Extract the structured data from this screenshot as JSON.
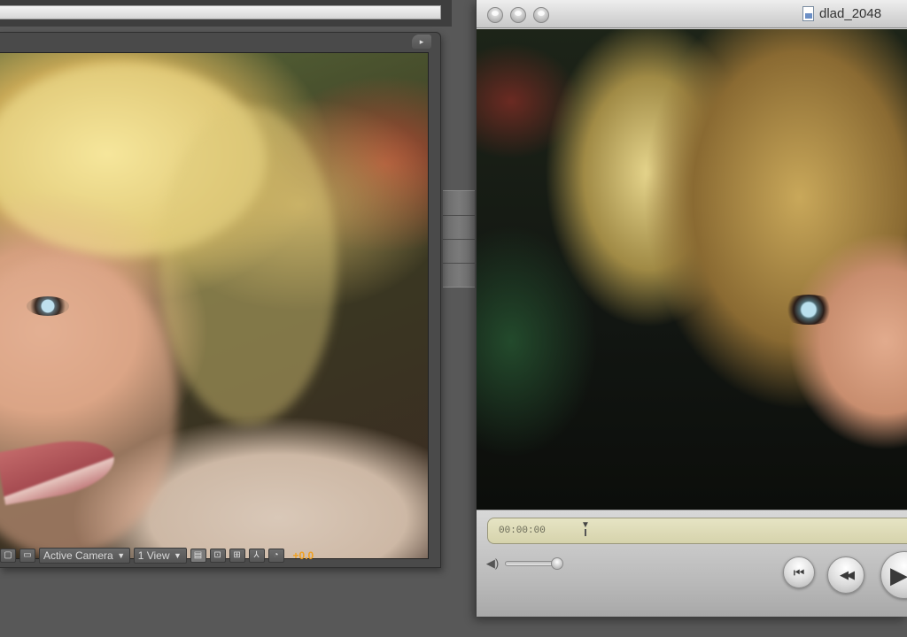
{
  "comp_viewer": {
    "menu_icon": "panel-menu-icon",
    "toolbar": {
      "camera_select": "Active Camera",
      "view_select": "1 View",
      "exposure_value": "+0.0",
      "icons": [
        "region-of-interest-icon",
        "comment-icon",
        "toggle-view-icon",
        "fit-icon",
        "grid-icon",
        "flowchart-icon",
        "reset-exposure-icon"
      ]
    }
  },
  "player": {
    "title": "dlad_2048",
    "timecode": "00:00:00",
    "icons": {
      "close": "close-icon",
      "minimize": "minimize-icon",
      "zoom": "zoom-icon",
      "document": "movie-document-icon",
      "volume": "speaker-icon",
      "prev": "skip-back-icon",
      "rewind": "rewind-icon",
      "play": "play-icon"
    },
    "glyphs": {
      "prev": "⏮",
      "rewind": "◀◀",
      "play": "▶",
      "speaker": "◀)",
      "menu": "▸"
    }
  },
  "colors": {
    "exposure": "#f0a020",
    "lcd": "#e6e4c4",
    "panel": "#4a4a4a"
  }
}
